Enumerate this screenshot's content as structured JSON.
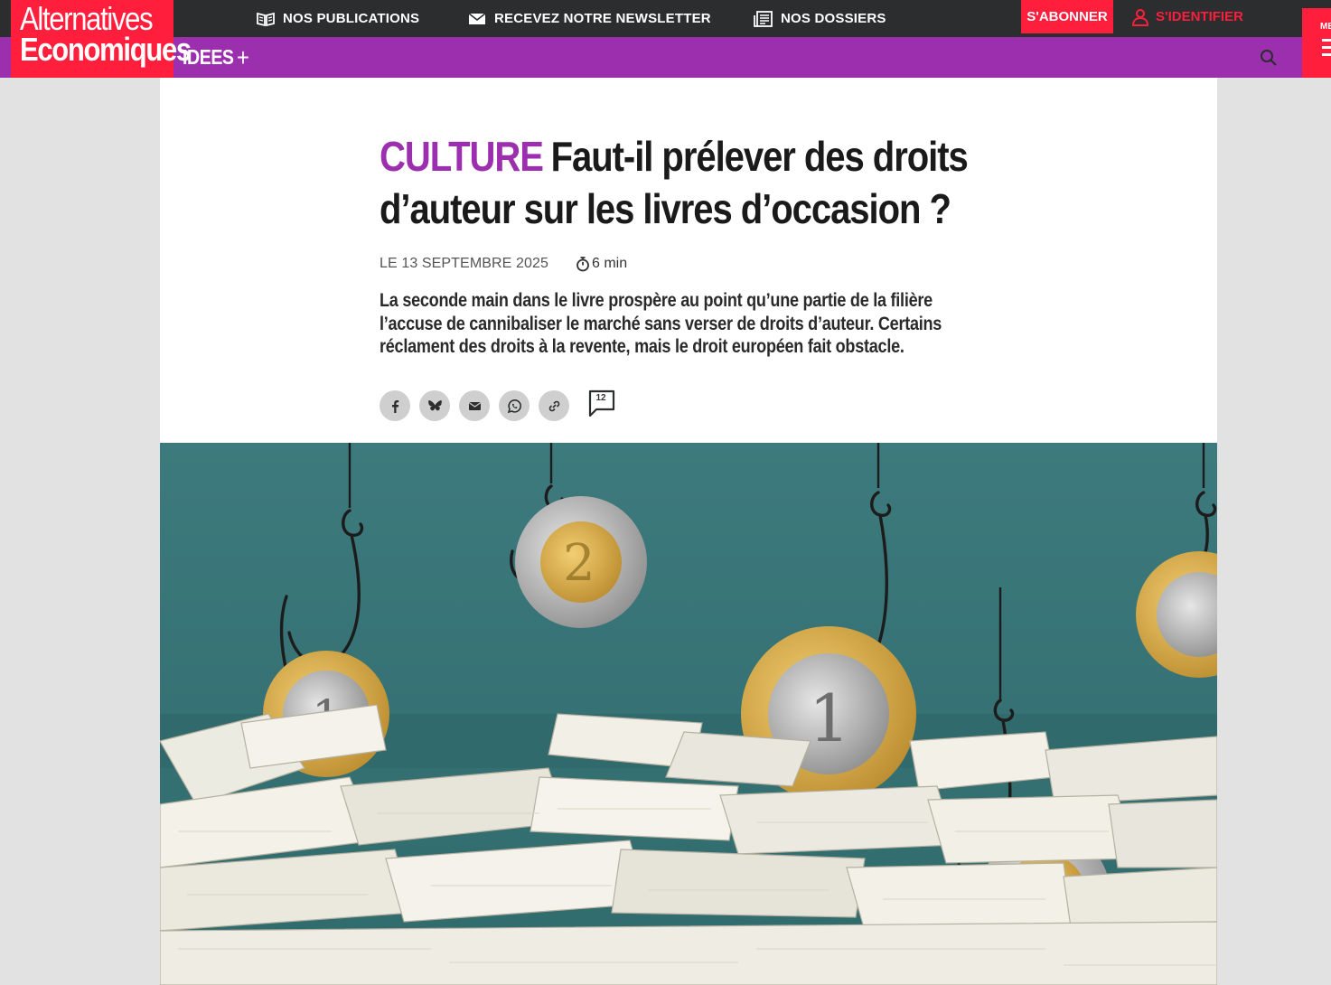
{
  "brand": {
    "line1": "Alternatives",
    "line2": "Economiques",
    "color": "#ff1e3c"
  },
  "topnav": {
    "publications": "NOS PUBLICATIONS",
    "newsletter": "RECEVEZ NOTRE NEWSLETTER",
    "dossiers": "NOS DOSSIERS",
    "subscribe": "S'ABONNER",
    "login": "S'IDENTIFIER",
    "menu": "ME"
  },
  "subnav": {
    "section": "IDEES",
    "plus": "+",
    "color": "#9b2fae"
  },
  "article": {
    "rubric": "CULTURE",
    "title": "Faut-il prélever des droits d’auteur sur les livres d’occasion ?",
    "date": "LE 13 SEPTEMBRE 2025",
    "reading_time": "6 min",
    "chapo": "La seconde main dans le livre prospère au point qu’une partie de la filière l’accuse de cannibaliser le marché sans verser de droits d’auteur. Certains réclament des droits à la revente, mais le droit européen fait obstacle.",
    "comment_count": "12"
  },
  "share_icons": [
    "facebook-icon",
    "bluesky-icon",
    "email-icon",
    "whatsapp-icon",
    "link-icon"
  ],
  "colors": {
    "topbar": "#2b2d2f",
    "accent_red": "#ff1e3c",
    "accent_purple": "#9b2fae",
    "hero_background": "#3f7f7f"
  }
}
